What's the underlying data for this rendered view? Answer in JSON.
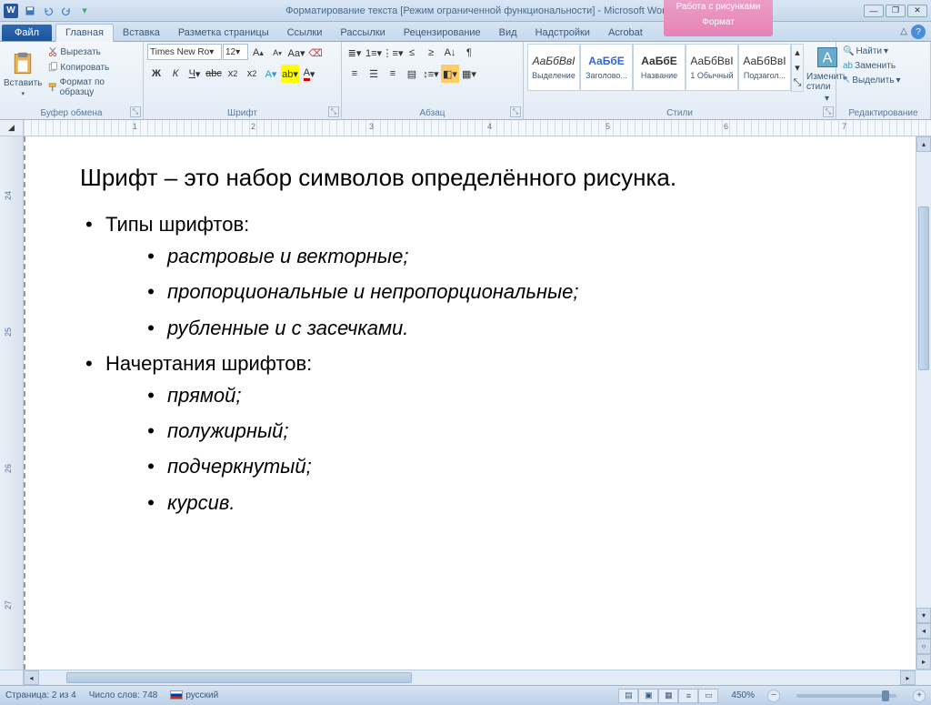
{
  "title": "Форматирование текста [Режим ограниченной функциональности] - Microsoft Word",
  "picture_tools": {
    "top": "Работа с рисунками",
    "tab": "Формат"
  },
  "tabs": {
    "file": "Файл",
    "items": [
      "Главная",
      "Вставка",
      "Разметка страницы",
      "Ссылки",
      "Рассылки",
      "Рецензирование",
      "Вид",
      "Надстройки",
      "Acrobat"
    ],
    "active": "Главная"
  },
  "ribbon": {
    "clipboard": {
      "label": "Буфер обмена",
      "paste": "Вставить",
      "cut": "Вырезать",
      "copy": "Копировать",
      "format_painter": "Формат по образцу"
    },
    "font": {
      "label": "Шрифт",
      "name": "Times New Ro",
      "size": "12"
    },
    "paragraph": {
      "label": "Абзац"
    },
    "styles": {
      "label": "Стили",
      "items": [
        {
          "preview": "АаБбВвІ",
          "name": "Выделение"
        },
        {
          "preview": "АаБбЕ",
          "name": "Заголово..."
        },
        {
          "preview": "АаБбЕ",
          "name": "Название"
        },
        {
          "preview": "АаБбВвІ",
          "name": "1 Обычный"
        },
        {
          "preview": "АаБбВвІ",
          "name": "Подзагол..."
        }
      ],
      "change": "Изменить стили"
    },
    "editing": {
      "label": "Редактирование",
      "find": "Найти",
      "replace": "Заменить",
      "select": "Выделить"
    }
  },
  "ruler": {
    "h": [
      "1",
      "2",
      "3",
      "4",
      "5",
      "6",
      "7"
    ],
    "v": [
      "24",
      "25",
      "26",
      "27"
    ]
  },
  "document": {
    "title_line": "Шрифт – это набор символов определённого  рисунка.",
    "items": [
      {
        "text": "Типы шрифтов:",
        "sub": [
          "растровые и векторные;",
          "пропорциональные и непропорциональные;",
          "рубленные и с засечками."
        ]
      },
      {
        "text": "Начертания шрифтов:",
        "sub": [
          "прямой;",
          "полужирный;",
          "подчеркнутый;",
          "курсив."
        ]
      }
    ]
  },
  "status": {
    "page": "Страница: 2 из 4",
    "words": "Число слов: 748",
    "lang": "русский",
    "zoom": "450%"
  }
}
